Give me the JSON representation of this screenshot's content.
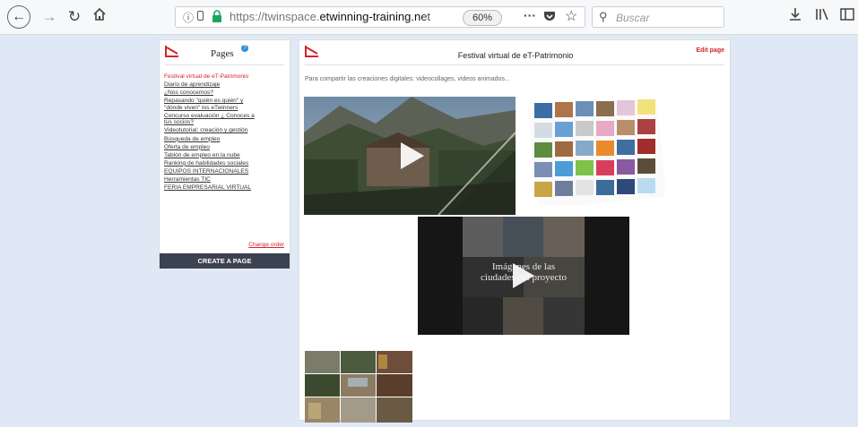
{
  "browser": {
    "url_prefix": "https://twinspace.",
    "url_domain": "etwinning-training.net",
    "zoom": "60%",
    "search_placeholder": "Buscar"
  },
  "sidebar": {
    "title": "Pages",
    "help": "?",
    "items": [
      {
        "label": "Festival virtual de eT-Patrimonio",
        "active": true
      },
      {
        "label": "Diario de aprendizaje"
      },
      {
        "label": "¿Nos conocemos?"
      },
      {
        "label": "Repasando \"quién es quién\" y"
      },
      {
        "label": "\"dónde viven\" los eTwinners"
      },
      {
        "label": "Concurso evaluación ¿ Conoces a"
      },
      {
        "label": "tus socios?"
      },
      {
        "label": "Videotutorial: creación y gestión"
      },
      {
        "label": "Búsqueda de empleo"
      },
      {
        "label": "Oferta de empleo"
      },
      {
        "label": "Tablón de empleo en la nube"
      },
      {
        "label": "Ranking de habilidades sociales"
      },
      {
        "label": "EQUIPOS INTERNACIONALES"
      },
      {
        "label": "Herramientas TIC"
      },
      {
        "label": "FERIA EMPRESARIAL VIRTUAL"
      }
    ],
    "change_order": "Change order",
    "create_button": "CREATE A PAGE"
  },
  "main": {
    "title": "Festival virtual de eT-Patrimonio",
    "edit": "Edit page",
    "description": "Para compartir las creaciones digitales: videocollages, videos animados...",
    "video2_caption_line1": "Imágenes de las",
    "video2_caption_line2": "ciudades del proyecto"
  },
  "colors": {
    "accent_red": "#d3232c",
    "create_button_bg": "#3d4250",
    "page_bg": "#dfe9f6"
  }
}
